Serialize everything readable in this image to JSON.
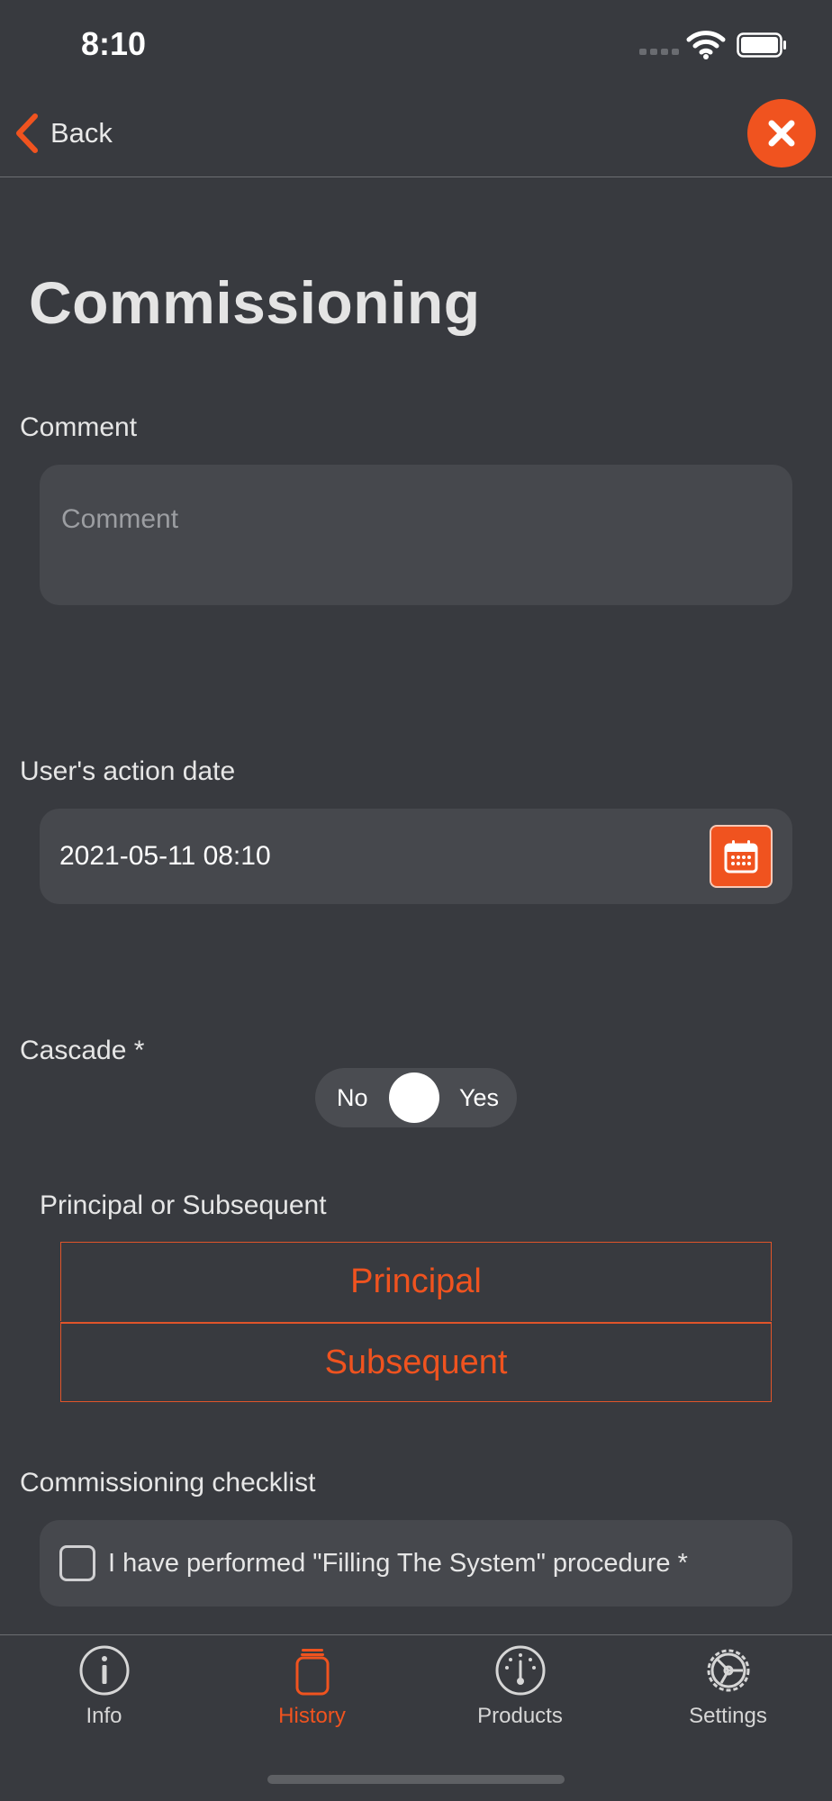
{
  "status_bar": {
    "time": "8:10"
  },
  "nav": {
    "back_label": "Back"
  },
  "page": {
    "title": "Commissioning"
  },
  "form": {
    "comment": {
      "label": "Comment",
      "placeholder": "Comment",
      "value": ""
    },
    "date": {
      "label": "User's action date",
      "value": "2021-05-11 08:10"
    },
    "cascade": {
      "label": "Cascade *",
      "off_label": "No",
      "on_label": "Yes"
    },
    "principal": {
      "label": "Principal or Subsequent",
      "options": [
        "Principal",
        "Subsequent"
      ]
    },
    "checklist": {
      "label": "Commissioning checklist",
      "items": [
        {
          "text": "I have performed \"Filling The System\" procedure *",
          "checked": false
        }
      ]
    }
  },
  "tabs": [
    {
      "label": "Info",
      "icon": "info-icon",
      "active": false
    },
    {
      "label": "History",
      "icon": "history-icon",
      "active": true
    },
    {
      "label": "Products",
      "icon": "products-icon",
      "active": false
    },
    {
      "label": "Settings",
      "icon": "settings-icon",
      "active": false
    }
  ],
  "colors": {
    "accent": "#f0531f",
    "background": "#383a3f",
    "field": "#46484d"
  }
}
